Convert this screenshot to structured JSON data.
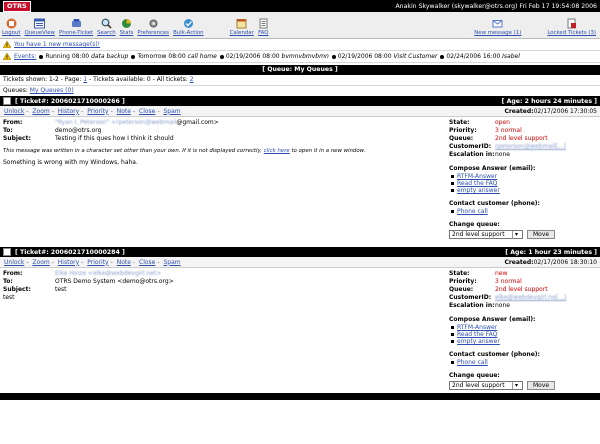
{
  "header": {
    "logo": "OTRS",
    "user": "Anakin Skywalker (skywalker@otrs.org) Fri Feb 17 19:54:08 2006"
  },
  "toolbar": {
    "items": [
      {
        "label": "Logout",
        "icon": "logout-icon"
      },
      {
        "label": "QueueView",
        "icon": "queueview-icon"
      },
      {
        "label": "Phone-Ticket",
        "icon": "phone-icon"
      },
      {
        "label": "Search",
        "icon": "search-icon"
      },
      {
        "label": "Stats",
        "icon": "stats-icon"
      },
      {
        "label": "Preferences",
        "icon": "preferences-icon"
      },
      {
        "label": "Bulk-Action",
        "icon": "bulk-action-icon"
      },
      {
        "label": "Calendar",
        "icon": "calendar-icon"
      },
      {
        "label": "FAQ",
        "icon": "faq-icon"
      }
    ],
    "right": [
      {
        "label": "New message (1)",
        "icon": "new-message-icon"
      },
      {
        "label": "Locked Tickets (3)",
        "icon": "locked-tickets-icon"
      }
    ]
  },
  "notices": {
    "new_message": "You have 1 new message(s)!",
    "events_label": "Events:",
    "events": [
      {
        "prefix": "Running 08:00",
        "title": "data backup"
      },
      {
        "prefix": "Tomorrow 08:00",
        "title": "call home"
      },
      {
        "prefix": "02/19/2006 08:00",
        "title": "bvmnvbmvbmn"
      },
      {
        "prefix": "02/19/2006 08:00",
        "title": "Visit Customer"
      },
      {
        "prefix": "02/24/2006 16:00",
        "title": "Isabel"
      }
    ]
  },
  "queue": {
    "title": "[ Queue: My Queues ]",
    "stats_shown": "Tickets shown: 1-2 - Page:",
    "stats_page": "1",
    "stats_available": "- Tickets available: 0 - All tickets:",
    "stats_all": "2",
    "queues_label": "Queues:",
    "queues_link": "My Queues (0)"
  },
  "ticket_menu": [
    "Unlock",
    "Zoom",
    "History",
    "Priority",
    "Note",
    "Close",
    "Spam"
  ],
  "labels": {
    "from": "From:",
    "to": "To:",
    "subject": "Subject:",
    "state": "State:",
    "priority": "Priority:",
    "queue": "Queue:",
    "customer_id": "CustomerID:",
    "escalation": "Escalation in:",
    "compose": "Compose Answer (email):",
    "contact": "Contact customer (phone):",
    "change_queue": "Change queue:",
    "move": "Move",
    "created": "Created:"
  },
  "tickets": [
    {
      "number": "[ Ticket#: 2006021710000266 ]",
      "age": "[ Age: 2 hours 24 minutes ]",
      "created": "02/17/2006 17:30:05",
      "from_blur": "\"Ryan I. Peterson\" <rpeterson@webmail",
      "from_rest": "@gmail.com>",
      "to": "demo@otrs.org",
      "subject": "Testing if this ques how I think it should",
      "note_pre": "This message was written in a character set other than your own. If it is not displayed correctly,",
      "note_link": "click here",
      "note_post": "to open it in a new window.",
      "body": "Something is wrong with my Windows, haha.",
      "state": "open",
      "priority": "3 normal",
      "queue": "2nd level support",
      "customer_id": "rpeterson@webmail[...]",
      "escalation": "none",
      "answers": [
        "RTFM-Answer",
        "Read the FAQ",
        "empty answer"
      ],
      "phone": "Phone call",
      "queue_select": "2nd level support"
    },
    {
      "number": "[ Ticket#: 2006021710000284 ]",
      "age": "[ Age: 1 hour 23 minutes ]",
      "created": "02/17/2006 18:30:10",
      "from_blur": "Elke Hinze <elke@webdevgirl.net>",
      "from_rest": "",
      "to": "OTRS Demo System <demo@otrs.org>",
      "subject": "test",
      "body": "test",
      "state": "new",
      "priority": "3 normal",
      "queue": "2nd level support",
      "customer_id": "elke@webdevgirl.ne[...]",
      "escalation": "none",
      "answers": [
        "RTFM-Answer",
        "Read the FAQ",
        "empty answer"
      ],
      "phone": "Phone call",
      "queue_select": "2nd level support"
    }
  ],
  "colors": {
    "accent": "#2d4fb0",
    "alert": "#d00000",
    "logo": "#c8102e",
    "bar": "#000000"
  }
}
